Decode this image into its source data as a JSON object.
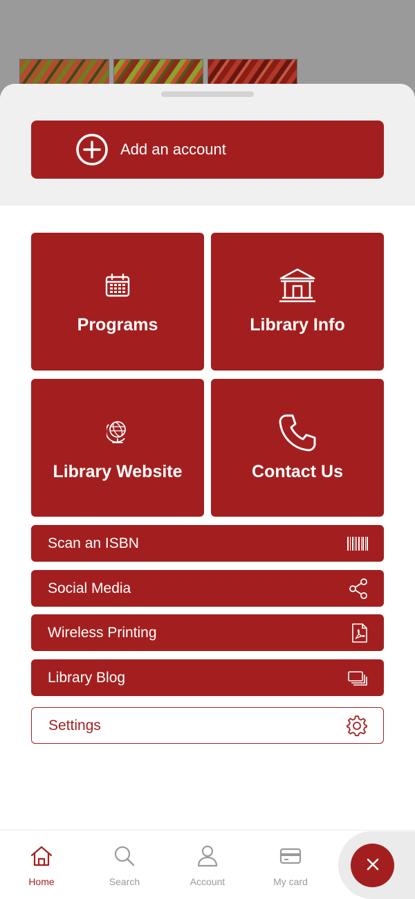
{
  "theme": {
    "accent": "#a31f1f",
    "backdrop": "#9a9a9a",
    "sheet_top": "#f0f0f0"
  },
  "add_account": {
    "label": "Add an account",
    "icon": "plus-circle-icon"
  },
  "tiles": [
    {
      "label": "Programs",
      "icon": "calendar-icon"
    },
    {
      "label": "Library Info",
      "icon": "building-icon"
    },
    {
      "label": "Library Website",
      "icon": "globe-icon"
    },
    {
      "label": "Contact Us",
      "icon": "phone-icon"
    }
  ],
  "rows": [
    {
      "label": "Scan an ISBN",
      "icon": "barcode-icon"
    },
    {
      "label": "Social Media",
      "icon": "share-icon"
    },
    {
      "label": "Wireless Printing",
      "icon": "pdf-file-icon"
    },
    {
      "label": "Library Blog",
      "icon": "stacked-cards-icon"
    },
    {
      "label": "Settings",
      "icon": "gear-icon"
    }
  ],
  "nav": [
    {
      "label": "Home",
      "icon": "home-icon",
      "active": true
    },
    {
      "label": "Search",
      "icon": "search-icon",
      "active": false
    },
    {
      "label": "Account",
      "icon": "user-icon",
      "active": false
    },
    {
      "label": "My card",
      "icon": "card-icon",
      "active": false
    }
  ],
  "close": {
    "icon": "close-icon"
  }
}
